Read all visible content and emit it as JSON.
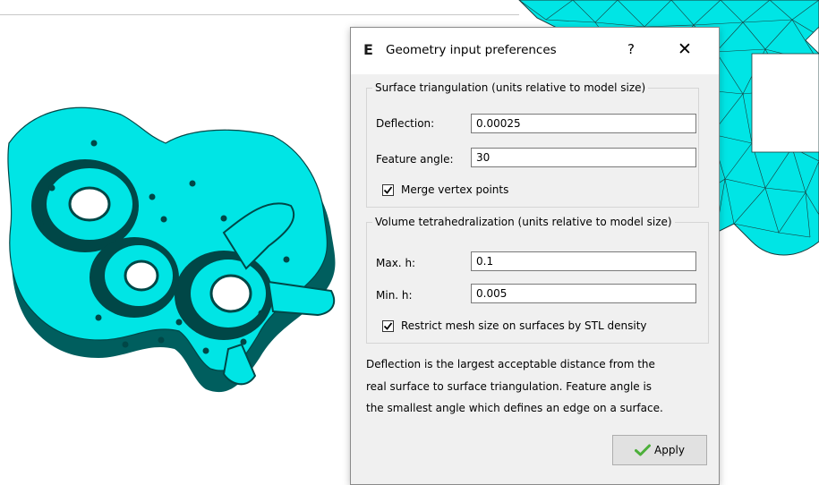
{
  "dialog": {
    "app_icon_letter": "E",
    "title": "Geometry input preferences",
    "help_label": "?",
    "close_label": "✕"
  },
  "surface_group": {
    "legend": "Surface triangulation (units relative to model size)",
    "deflection_label": "Deflection:",
    "deflection_value": "0.00025",
    "feature_angle_label": "Feature angle:",
    "feature_angle_value": "30",
    "merge_label": "Merge vertex points",
    "merge_checked": true
  },
  "volume_group": {
    "legend": "Volume tetrahedralization (units relative to model size)",
    "maxh_label": "Max. h:",
    "maxh_value": "0.1",
    "minh_label": "Min. h:",
    "minh_value": "0.005",
    "restrict_label": "Restrict mesh size on surfaces by STL density",
    "restrict_checked": true
  },
  "description": {
    "line1": "Deflection is the largest acceptable distance from the",
    "line2": "real surface to surface triangulation. Feature angle is",
    "line3": "the smallest angle which defines an edge on a surface."
  },
  "apply_label": "Apply",
  "colors": {
    "model_fill": "#00e5e5",
    "model_shadow": "#005e5e",
    "mesh_lines": "#1a3a3a",
    "apply_check": "#4caf3a"
  },
  "icons": {
    "app": "e-logo-icon",
    "help": "question-icon",
    "close": "close-icon",
    "apply": "green-check-icon"
  }
}
